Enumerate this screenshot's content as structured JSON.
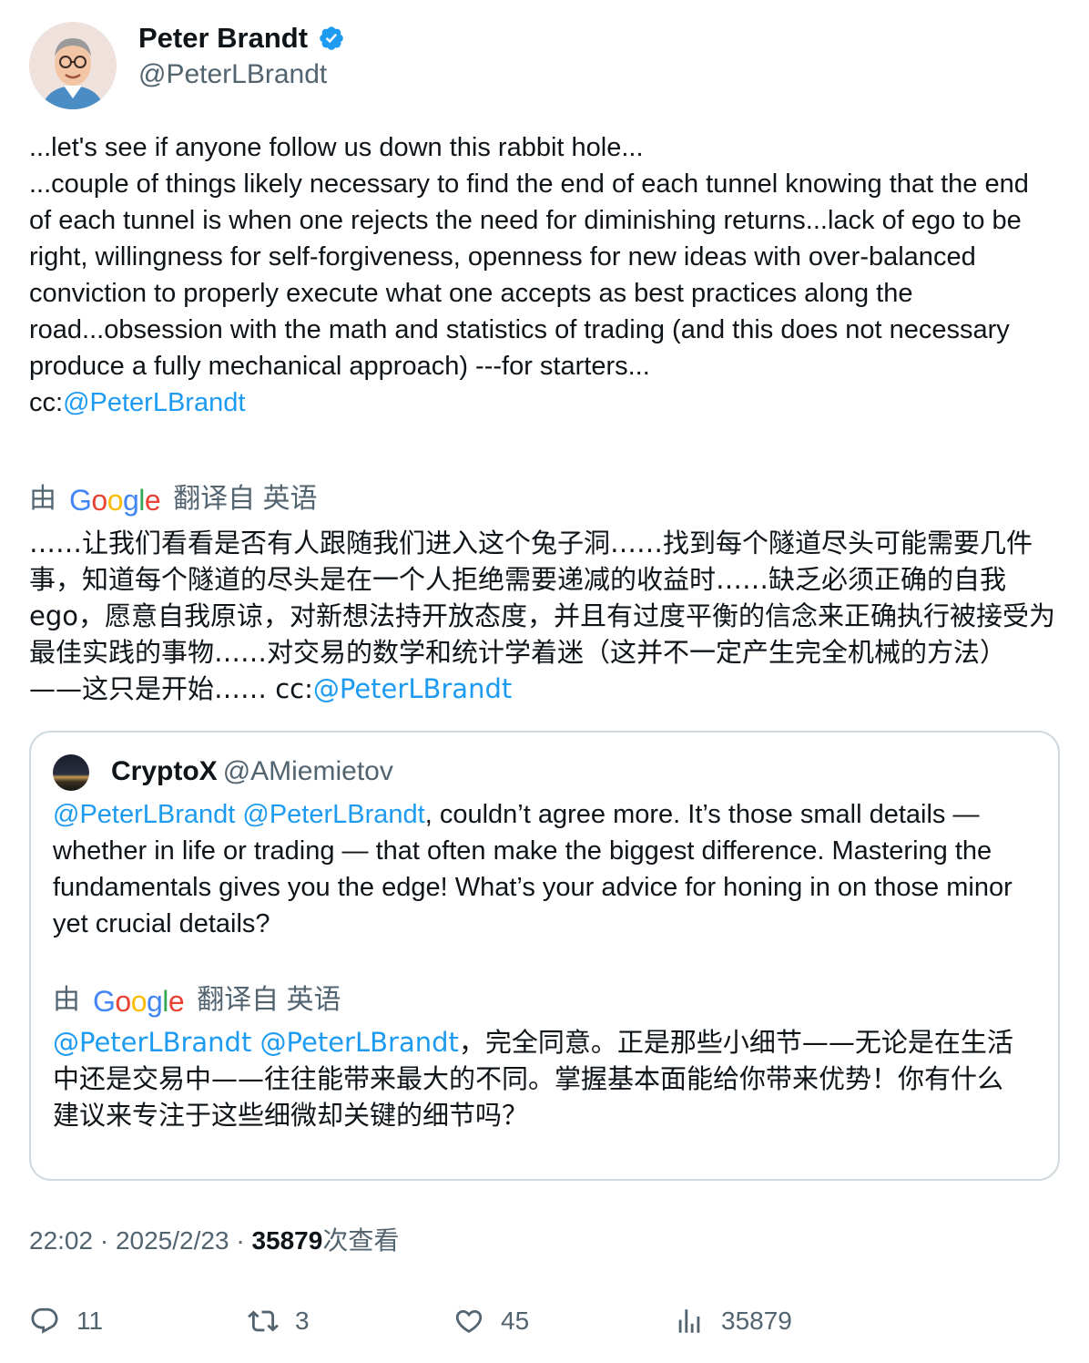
{
  "author": {
    "display_name": "Peter Brandt",
    "handle": "@PeterLBrandt"
  },
  "tweet": {
    "text": "...let's see if anyone follow us down this rabbit hole...\n...couple of things likely necessary to find the end of each tunnel knowing that the end of each tunnel is when one rejects the need for diminishing returns...lack of ego to be right, willingness for self-forgiveness, openness for new ideas with over-balanced conviction to properly execute what one accepts as best practices along the road...obsession with the math and statistics of trading (and this does not necessary produce a fully mechanical approach) ---for starters...\ncc:",
    "mention": "@PeterLBrandt"
  },
  "translation": {
    "by_label": "由",
    "google": "Google",
    "from_label": "翻译自 英语",
    "text": "……让我们看看是否有人跟随我们进入这个兔子洞……找到每个隧道尽头可能需要几件事，知道每个隧道的尽头是在一个人拒绝需要递减的收益时……缺乏必须正确的自我 ego，愿意自我原谅，对新想法持开放态度，并且有过度平衡的信念来正确执行被接受为最佳实践的事物……对交易的数学和统计学着迷（这并不一定产生完全机械的方法）——这只是开始…… cc:",
    "mention": "@PeterLBrandt"
  },
  "quote": {
    "display_name": "CryptoX",
    "handle": "@AMiemietov",
    "mentions": "@PeterLBrandt @PeterLBrandt",
    "text": ", couldn’t agree more. It’s those small details — whether in life or trading — that often make the biggest difference. Mastering the fundamentals gives you the edge! What’s your advice for honing in on those minor yet crucial details?",
    "translation": {
      "by_label": "由",
      "google": "Google",
      "from_label": "翻译自 英语",
      "mentions": "@PeterLBrandt @PeterLBrandt",
      "text": "，完全同意。正是那些小细节——无论是在生活中还是交易中——往往能带来最大的不同。掌握基本面能给你带来优势！你有什么建议来专注于这些细微却关键的细节吗？"
    }
  },
  "meta": {
    "time": "22:02",
    "date": "2025/2/23",
    "separator": "·",
    "views_count": "35879",
    "views_label": "次查看"
  },
  "actions": {
    "replies": "11",
    "retweets": "3",
    "likes": "45",
    "views": "35879"
  },
  "colors": {
    "link": "#1d9bf0",
    "verified": "#1d9bf0",
    "muted": "#536471",
    "text": "#0f1419"
  }
}
